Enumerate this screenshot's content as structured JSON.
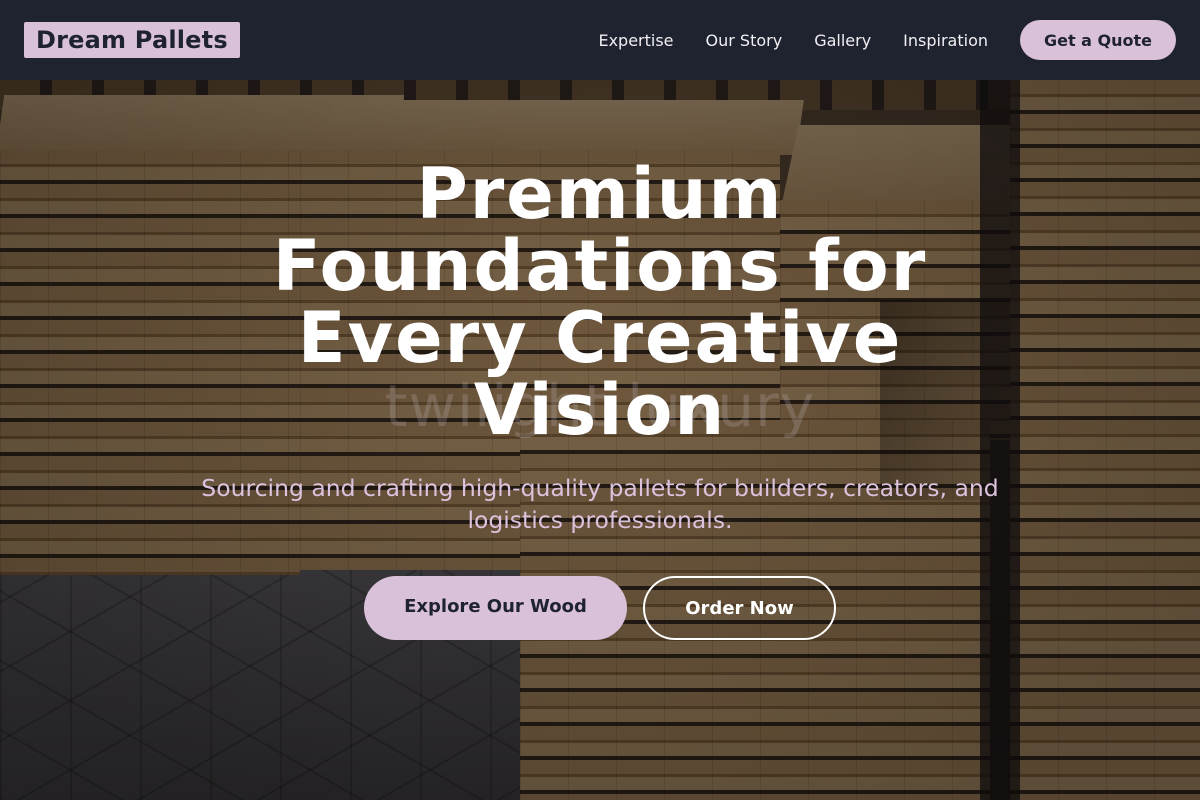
{
  "brand": {
    "name": "Dream Pallets",
    "accent": "#d8c1d9",
    "header_bg": "#1e2332"
  },
  "nav": {
    "items": [
      {
        "label": "Expertise"
      },
      {
        "label": "Our Story"
      },
      {
        "label": "Gallery"
      },
      {
        "label": "Inspiration"
      }
    ],
    "cta_label": "Get a Quote"
  },
  "hero": {
    "title": "Premium Foundations for Every Creative Vision",
    "subtitle": "Sourcing and crafting high-quality pallets for builders, creators, and logistics professionals.",
    "watermark": "twilight luxury",
    "primary_cta": "Explore Our Wood",
    "secondary_cta": "Order Now",
    "background": "stacked lumber photo"
  }
}
